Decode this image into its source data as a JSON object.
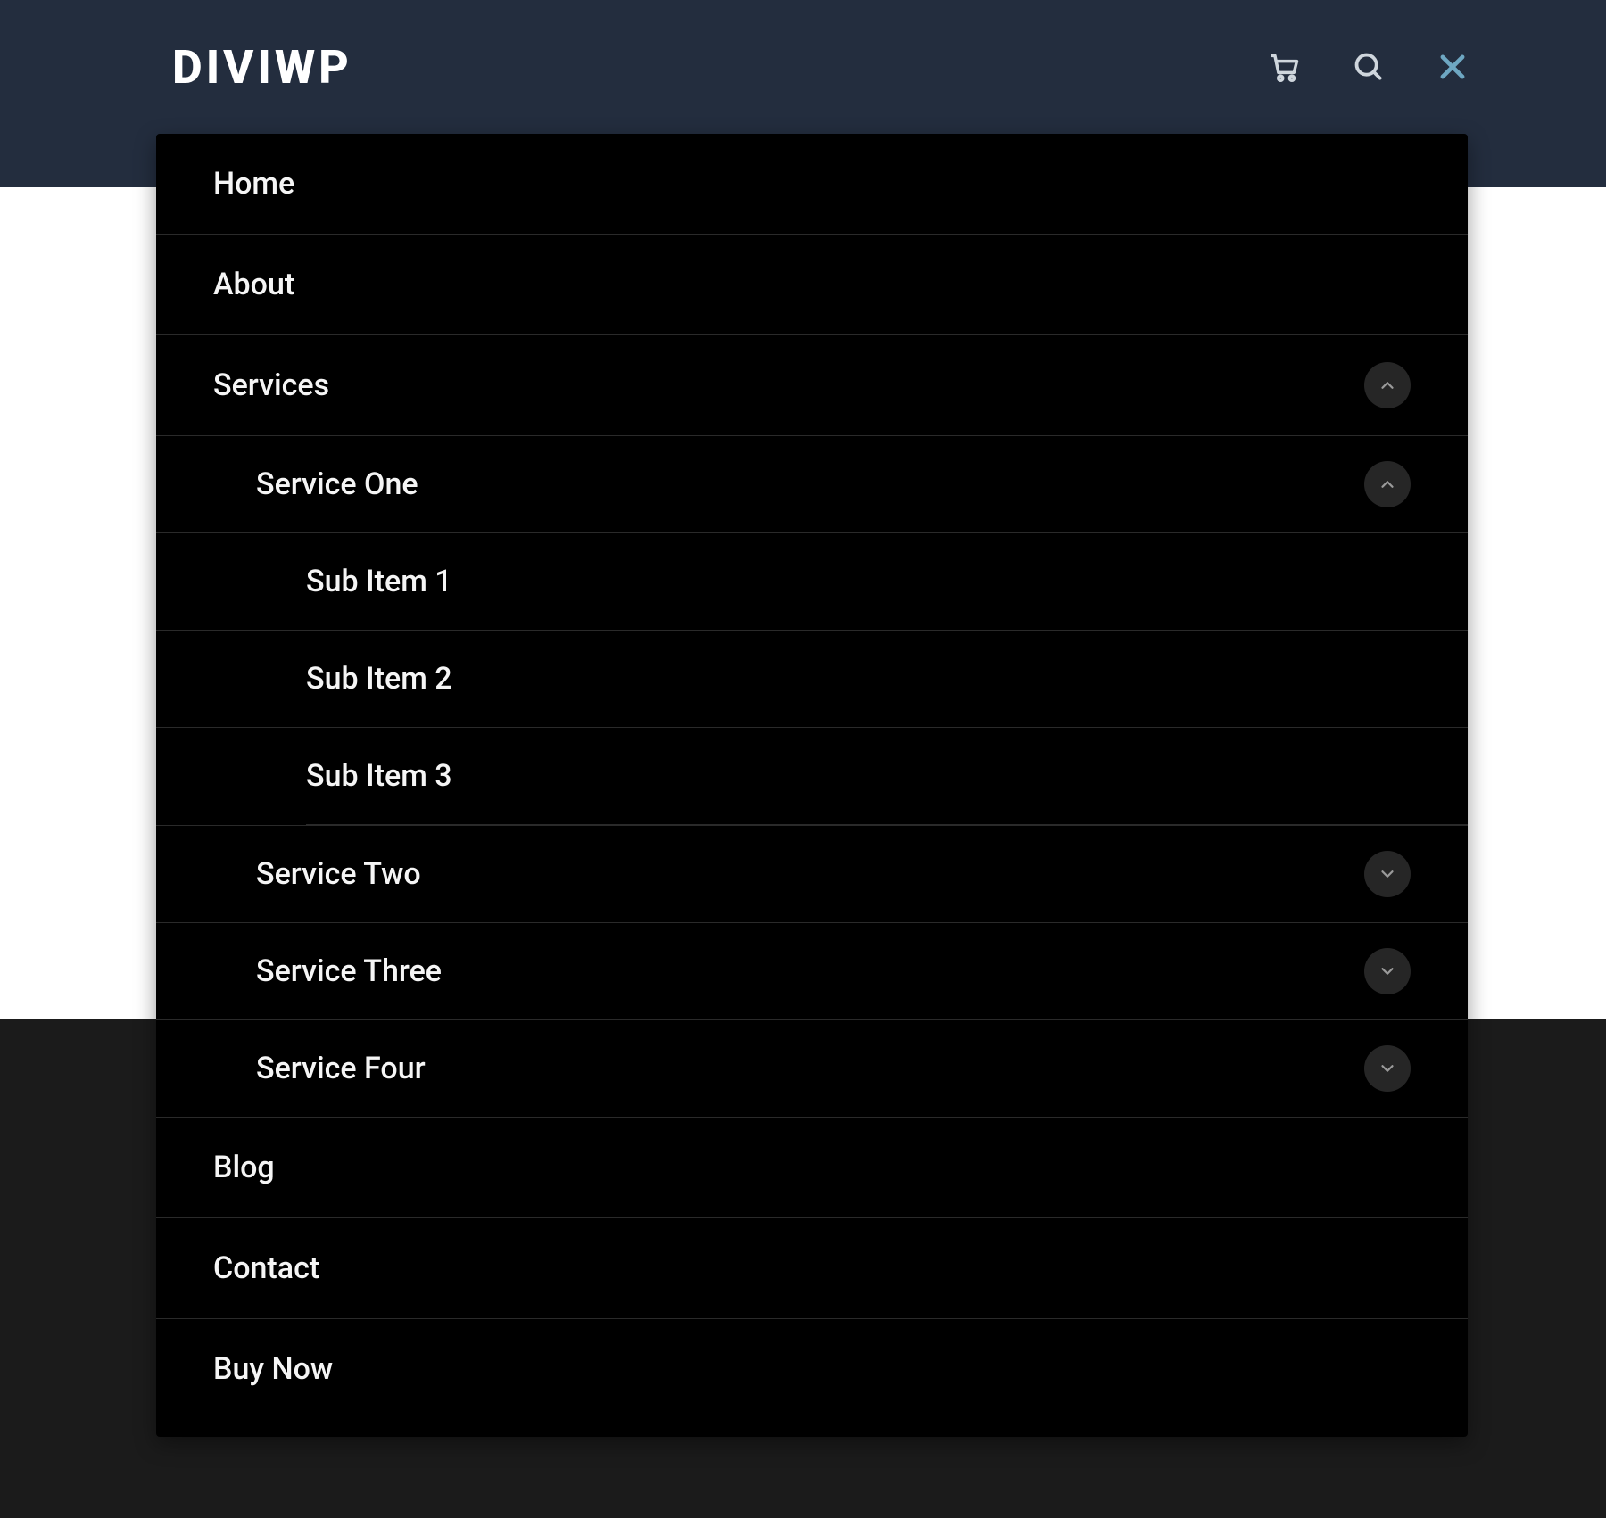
{
  "logo": {
    "mark_letter": "D",
    "text": "DIVIWP"
  },
  "header": {
    "cart_icon": "cart-icon",
    "search_icon": "search-icon",
    "close_icon": "close-icon"
  },
  "menu": {
    "items": [
      {
        "label": "Home"
      },
      {
        "label": "About"
      },
      {
        "label": "Services",
        "expanded": true,
        "children": [
          {
            "label": "Service One",
            "expanded": true,
            "children": [
              {
                "label": "Sub Item 1"
              },
              {
                "label": "Sub Item 2"
              },
              {
                "label": "Sub Item 3"
              }
            ]
          },
          {
            "label": "Service Two",
            "expanded": false,
            "has_children": true
          },
          {
            "label": "Service Three",
            "expanded": false,
            "has_children": true
          },
          {
            "label": "Service Four",
            "expanded": false,
            "has_children": true
          }
        ]
      },
      {
        "label": "Blog"
      },
      {
        "label": "Contact"
      },
      {
        "label": "Buy Now"
      }
    ]
  }
}
